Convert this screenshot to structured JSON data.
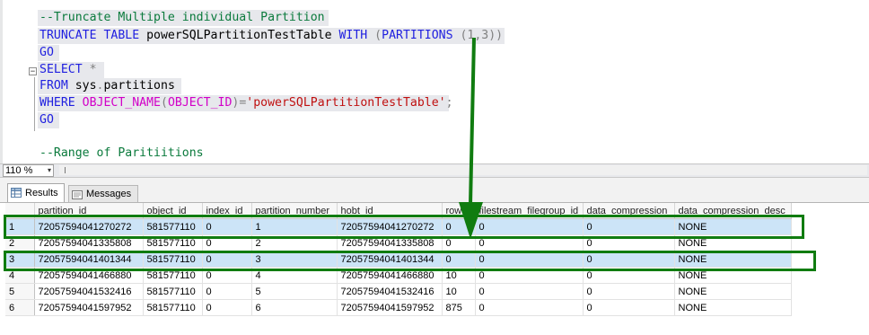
{
  "editor": {
    "lines": [
      {
        "parts": [
          {
            "t": "--Truncate Multiple individual Partition",
            "c": "cm"
          }
        ]
      },
      {
        "parts": [
          {
            "t": "TRUNCATE TABLE ",
            "c": "kw"
          },
          {
            "t": "powerSQLPartitionTestTable ",
            "c": ""
          },
          {
            "t": "WITH ",
            "c": "kw"
          },
          {
            "t": "(",
            "c": "gray"
          },
          {
            "t": "PARTITIONS ",
            "c": "kw"
          },
          {
            "t": "(1,3))",
            "c": "gray"
          }
        ]
      },
      {
        "parts": [
          {
            "t": "GO",
            "c": "kw"
          }
        ]
      },
      {
        "parts": [
          {
            "t": "SELECT ",
            "c": "kw"
          },
          {
            "t": "*",
            "c": "gray"
          }
        ]
      },
      {
        "parts": [
          {
            "t": "FROM ",
            "c": "kw"
          },
          {
            "t": "sys",
            "c": ""
          },
          {
            "t": ".",
            "c": "gray"
          },
          {
            "t": "partitions",
            "c": ""
          }
        ]
      },
      {
        "parts": [
          {
            "t": "WHERE ",
            "c": "kw"
          },
          {
            "t": "OBJECT_NAME",
            "c": "pink"
          },
          {
            "t": "(",
            "c": "gray"
          },
          {
            "t": "OBJECT_ID",
            "c": "pink"
          },
          {
            "t": ")=",
            "c": "gray"
          },
          {
            "t": "'powerSQLPartitionTestTable'",
            "c": "str"
          },
          {
            "t": ";",
            "c": "gray"
          }
        ]
      },
      {
        "parts": [
          {
            "t": "GO",
            "c": "kw"
          }
        ]
      },
      {
        "parts": [
          {
            "t": "",
            "c": ""
          }
        ]
      },
      {
        "parts": [
          {
            "t": "--Range of Paritiitions",
            "c": "cm"
          }
        ]
      }
    ],
    "collapse_glyph": "−"
  },
  "zoom": {
    "value": "110 %",
    "dropdown_glyph": "▾"
  },
  "tabs": {
    "results": "Results",
    "messages": "Messages"
  },
  "grid": {
    "columns": [
      "partition_id",
      "object_id",
      "index_id",
      "partition_number",
      "hobt_id",
      "rows",
      "filestream_filegroup_id",
      "data_compression",
      "data_compression_desc"
    ],
    "rows": [
      {
        "num": "1",
        "cells": [
          "72057594041270272",
          "581577110",
          "0",
          "1",
          "72057594041270272",
          "0",
          "0",
          "0",
          "NONE"
        ],
        "highlight": true
      },
      {
        "num": "2",
        "cells": [
          "72057594041335808",
          "581577110",
          "0",
          "2",
          "72057594041335808",
          "0",
          "0",
          "0",
          "NONE"
        ],
        "highlight": false
      },
      {
        "num": "3",
        "cells": [
          "72057594041401344",
          "581577110",
          "0",
          "3",
          "72057594041401344",
          "0",
          "0",
          "0",
          "NONE"
        ],
        "highlight": true
      },
      {
        "num": "4",
        "cells": [
          "72057594041466880",
          "581577110",
          "0",
          "4",
          "72057594041466880",
          "10",
          "0",
          "0",
          "NONE"
        ],
        "highlight": false
      },
      {
        "num": "5",
        "cells": [
          "72057594041532416",
          "581577110",
          "0",
          "5",
          "72057594041532416",
          "10",
          "0",
          "0",
          "NONE"
        ],
        "highlight": false
      },
      {
        "num": "6",
        "cells": [
          "72057594041597952",
          "581577110",
          "0",
          "6",
          "72057594041597952",
          "875",
          "0",
          "0",
          "NONE"
        ],
        "highlight": false
      }
    ]
  },
  "colors": {
    "annotation": "#107c10",
    "highlight_row": "#cce4f7",
    "keyword": "#1f1fe0",
    "comment": "#0a7a3c"
  },
  "icons": {
    "results_tab": "grid-icon",
    "messages_tab": "messages-icon"
  }
}
